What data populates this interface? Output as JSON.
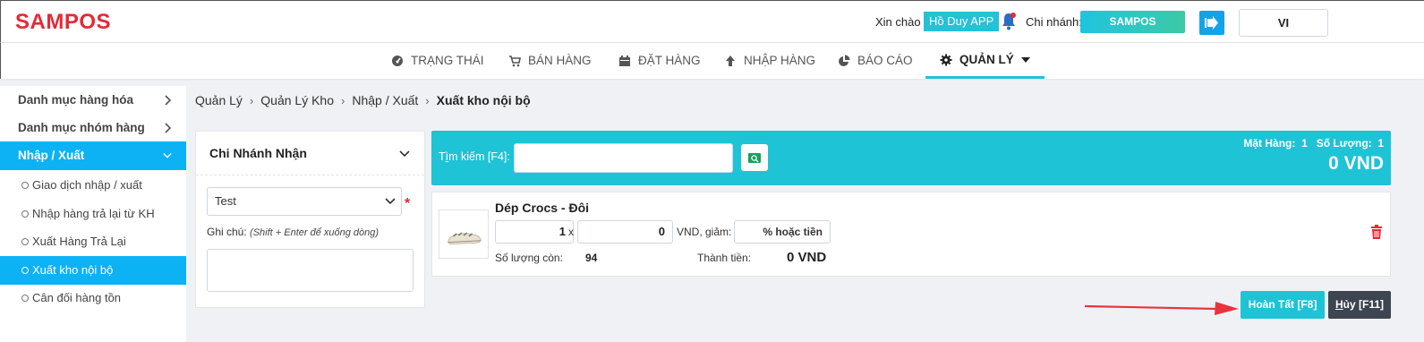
{
  "app": {
    "logo": "SAMPOS"
  },
  "header": {
    "greeting": "Xin chào",
    "user": "Hồ Duy APP",
    "branch_label": "Chi nhánh:",
    "branch": "SAMPOS",
    "language": "VI"
  },
  "nav": {
    "items": [
      {
        "label": "TRẠNG THÁI",
        "icon": "dashboard-icon"
      },
      {
        "label": "BÁN HÀNG",
        "icon": "cart-icon"
      },
      {
        "label": "ĐẶT HÀNG",
        "icon": "calendar-icon"
      },
      {
        "label": "NHẬP HÀNG",
        "icon": "arrow-up-icon"
      },
      {
        "label": "BÁO CÁO",
        "icon": "pie-chart-icon"
      },
      {
        "label": "QUẢN LÝ",
        "icon": "gear-icon"
      }
    ]
  },
  "sidebar": {
    "groups": [
      {
        "label": "Danh mục hàng hóa"
      },
      {
        "label": "Danh mục nhóm hàng"
      },
      {
        "label": "Nhập / Xuất"
      }
    ],
    "subitems": [
      {
        "label": "Giao dịch nhập / xuất"
      },
      {
        "label": "Nhập hàng trả lại từ KH"
      },
      {
        "label": "Xuất Hàng Trả Lại"
      },
      {
        "label": "Xuất kho nội bộ"
      },
      {
        "label": "Cân đối hàng tồn"
      }
    ]
  },
  "breadcrumb": [
    "Quản Lý",
    "Quản Lý Kho",
    "Nhập / Xuất",
    "Xuất kho nội bộ"
  ],
  "branch_panel": {
    "title": "Chi Nhánh Nhận",
    "selected": "Test",
    "note_label": "Ghi chú:",
    "note_hint": "(Shift + Enter để xuống dòng)"
  },
  "search": {
    "label_prefix": "T",
    "label_underlined": "ì",
    "label_suffix": "m kiếm [F4]:",
    "items_label": "Mặt Hàng:",
    "items_count": "1",
    "qty_label": "Số Lượng:",
    "qty_count": "1",
    "total": "0 VND"
  },
  "product": {
    "name": "Dép Crocs - Đôi",
    "quantity": "1",
    "x": "x",
    "price": "0",
    "vnd_discount": "VND, giảm:",
    "discount": "% hoặc tiền",
    "stock_label": "Số lượng còn:",
    "stock": "94",
    "amount_label": "Thành tiền:",
    "amount": "0 VND"
  },
  "actions": {
    "done": "Hoàn Tất [F8]",
    "cancel_underlined": "H",
    "cancel_rest": "ủy [F11]"
  },
  "colors": {
    "brand": "#e42a37",
    "accent": "#1ec3d6",
    "sidebar_active": "#0cb2f4",
    "dark_button": "#3d4550"
  }
}
